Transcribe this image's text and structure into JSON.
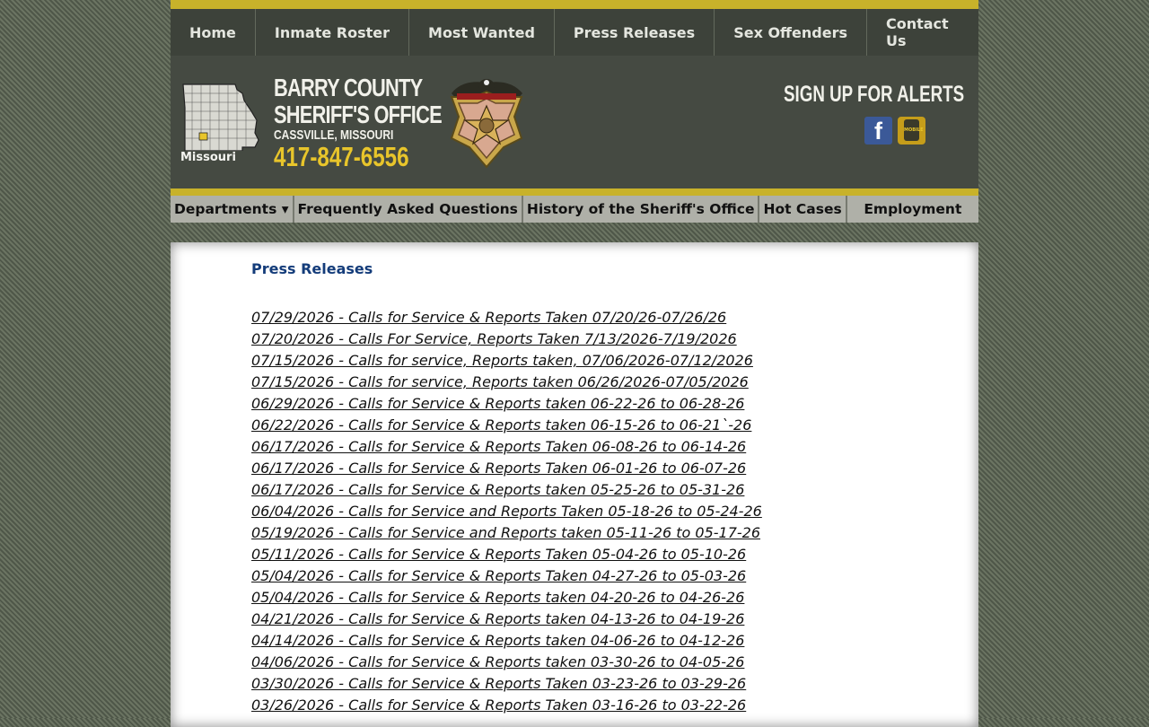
{
  "top_nav": [
    "Home",
    "Inmate Roster",
    "Most Wanted",
    "Press Releases",
    "Sex Offenders",
    "Contact Us"
  ],
  "header": {
    "map_label": "Missouri",
    "title_line1": "BARRY COUNTY",
    "title_line2": "SHERIFF'S OFFICE",
    "location": "CASSVILLE, MISSOURI",
    "phone": "417-847-6556",
    "alerts": "SIGN UP FOR ALERTS",
    "facebook_glyph": "f",
    "mobile_label": "MOBILE"
  },
  "sub_nav": [
    "Departments ▾",
    "Frequently Asked Questions",
    "History of the Sheriff's Office",
    "Hot Cases",
    "Employment"
  ],
  "content": {
    "heading": "Press Releases",
    "releases": [
      "07/29/2026 - Calls for Service & Reports Taken 07/20/26-07/26/26",
      "07/20/2026 - Calls For Service, Reports Taken 7/13/2026-7/19/2026",
      "07/15/2026 - Calls for service, Reports taken, 07/06/2026-07/12/2026",
      "07/15/2026 - Calls for service, Reports taken 06/26/2026-07/05/2026",
      "06/29/2026 - Calls for Service & Reports taken 06-22-26 to 06-28-26",
      "06/22/2026 - Calls for Service & Reports taken 06-15-26 to 06-21`-26",
      "06/17/2026 - Calls for Service & Reports Taken 06-08-26 to 06-14-26",
      "06/17/2026 - Calls for Service & Reports Taken 06-01-26 to 06-07-26",
      "06/17/2026 - Calls for Service & Reports taken 05-25-26 to 05-31-26",
      "06/04/2026 - Calls for Service and Reports Taken 05-18-26 to 05-24-26",
      "05/19/2026 - Calls for Service and Reports taken 05-11-26 to 05-17-26",
      "05/11/2026 - Calls for Service & Reports Taken 05-04-26 to 05-10-26",
      "05/04/2026 - Calls for Service & Reports Taken 04-27-26 to 05-03-26",
      "05/04/2026 - Calls for Service & Reports taken 04-20-26 to 04-26-26",
      "04/21/2026 - Calls for Service & Reports taken 04-13-26 to 04-19-26",
      "04/14/2026 - Calls for Service & Reports taken 04-06-26 to 04-12-26",
      "04/06/2026 - Calls for Service & Reports taken 03-30-26 to 04-05-26",
      "03/30/2026 - Calls for Service & Reports Taken 03-23-26 to 03-29-26",
      "03/26/2026 - Calls for Service & Reports Taken 03-16-26 to 03-22-26"
    ]
  }
}
